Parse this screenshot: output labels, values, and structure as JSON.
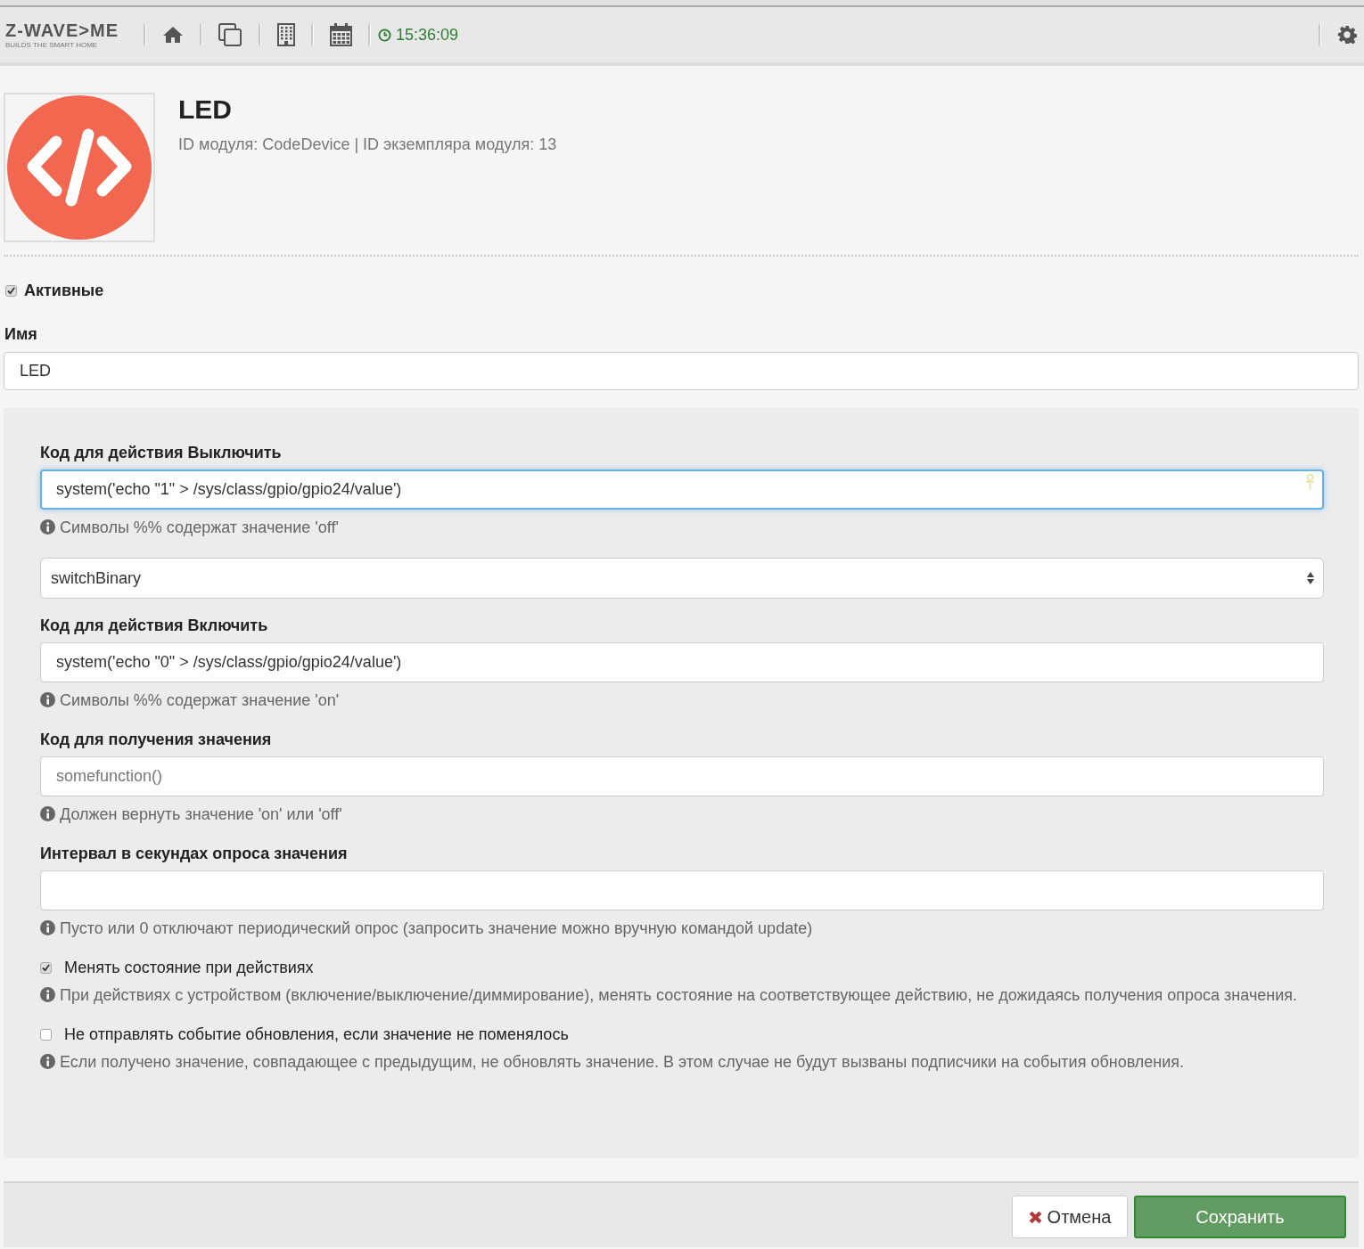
{
  "topbar": {
    "logo": "Z-WAVE>ME",
    "tagline": "BUILDS THE SMART HOME",
    "clock": "15:36:09"
  },
  "module": {
    "title": "LED",
    "subtitle": "ID модуля: CodeDevice | ID экземпляра модуля: 13"
  },
  "active": {
    "label": "Активные",
    "checked": true
  },
  "name_field": {
    "label": "Имя",
    "value": "LED"
  },
  "panel": {
    "items": [
      {
        "kind": "text",
        "label": "Код для действия Выключить",
        "value": "system('echo \"1\" > /sys/class/gpio/gpio24/value')",
        "focused": true,
        "hint": "Символы %% содержат значение 'off'"
      },
      {
        "kind": "select",
        "value": "switchBinary"
      },
      {
        "kind": "text",
        "label": "Код для действия Включить",
        "value": "system('echo \"0\" > /sys/class/gpio/gpio24/value')",
        "focused": false,
        "hint": "Символы %% содержат значение 'on'"
      },
      {
        "kind": "text",
        "label": "Код для получения значения",
        "placeholder": "somefunction()",
        "focused": false,
        "hint": "Должен вернуть значение 'on' или 'off'"
      },
      {
        "kind": "text",
        "label": "Интервал в секундах опроса значения",
        "focused": false,
        "hint": "Пусто или 0 отключают периодический опрос (запросить значение можно вручную командой update)"
      },
      {
        "kind": "checkbox",
        "label": "Менять состояние при действиях",
        "checked": true,
        "hint": "При действиях с устройством (включение/выключение/диммирование), менять состояние на соответствующее действию, не дожидаясь получения опроса значения."
      },
      {
        "kind": "checkbox",
        "label": "Не отправлять событие обновления, если значение не поменялось",
        "checked": false,
        "hint": "Если получено значение, совпадающее с предыдущим, не обновлять значение. В этом случае не будут вызваны подписчики на события обновления."
      }
    ]
  },
  "footer": {
    "cancel": "Отмена",
    "save": "Сохранить"
  }
}
